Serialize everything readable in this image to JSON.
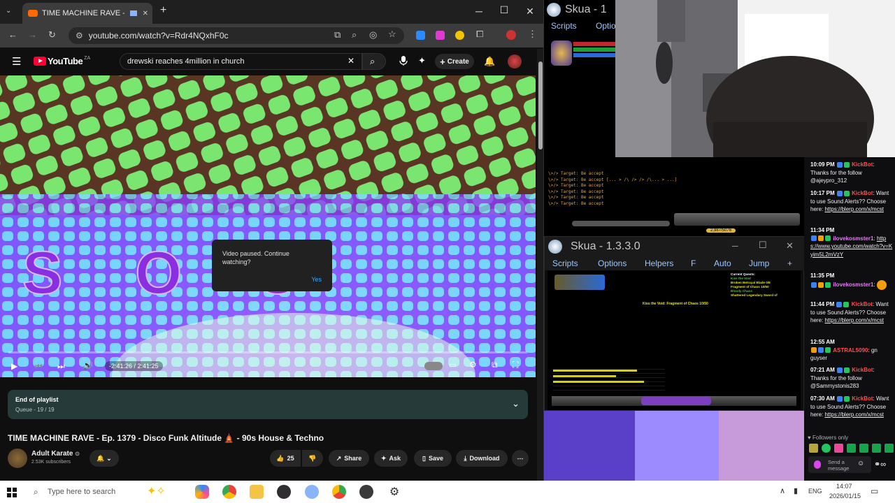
{
  "browser": {
    "tab_title": "TIME MACHINE RAVE - Ep.",
    "new_tab": "+",
    "minimize": "─",
    "maximize": "☐",
    "close": "✕",
    "url": "youtube.com/watch?v=Rdr4NQxhF0c"
  },
  "youtube": {
    "logo_text": "YouTube",
    "region": "ZA",
    "search_query": "drewski reaches 4million in church",
    "create_label": "Create",
    "player": {
      "overlay_letters": "S O C",
      "dialog_message": "Video paused. Continue watching?",
      "dialog_yes": "Yes",
      "time": "-2:41:26 / 2:41:25"
    },
    "playlist": {
      "title": "End of playlist",
      "queue": "Queue - 19 / 19"
    },
    "video_title": "TIME MACHINE RAVE - Ep. 1379 - Disco Funk Altitude 🛕 - 90s House & Techno",
    "channel_name": "Adult Karate",
    "subscribers": "2.53K subscribers",
    "likes": "25",
    "share": "Share",
    "ask": "Ask",
    "save": "Save",
    "download": "Download"
  },
  "skua_top": {
    "title": "Skua - 1",
    "menu_scripts": "Scripts",
    "menu_options": "Optio"
  },
  "skua_main": {
    "title": "Skua - 1.3.3.0",
    "menu": [
      "Scripts",
      "Options",
      "Helpers",
      "F",
      "Auto",
      "Jump",
      "+"
    ],
    "quest_header": "Current Quests:",
    "quest_lines": [
      "Kiss the Void",
      "Broken Betrayal Blade 0/8",
      "Fragment of Chaos 10/50",
      "Bloody Chaos",
      "Shattered Legendary Sword of"
    ],
    "center_text": "Kiss the Void: Fragment of Chaos 10/50"
  },
  "game_log": {
    "lines": [
      "\\>/> Target: Be accept",
      "\\>/> Target: Be accept  [... > /\\ /> /> /\\... > ...]",
      "\\>/> Target: Be accept",
      "\\>/> Target: Be accept",
      "\\>/> Target: Be accept",
      "\\>/> Target: Be accept"
    ],
    "level_bar": "2,987/5076"
  },
  "chat": {
    "messages": [
      {
        "time": "10:09 PM",
        "user": "KickBot",
        "text": "Thanks for the follow @ajeypro_312"
      },
      {
        "time": "10:17 PM",
        "user": "KickBot",
        "text": "Want to use Sound Alerts?? Choose here:",
        "link": "https://blerp.com/x/mcst"
      },
      {
        "time": "11:34 PM",
        "user": "ilovekosmster1",
        "text": "",
        "link": "https://www.youtube.com/watch?v=Kyim5L2mVzY"
      },
      {
        "time": "11:35 PM",
        "user": "ilovekosmster1",
        "text": ""
      },
      {
        "time": "11:44 PM",
        "user": "KickBot",
        "text": "Want to use Sound Alerts?? Choose here:",
        "link": "https://blerp.com/x/mcst"
      },
      {
        "time": "12:55 AM",
        "user": "ASTRAL5090",
        "text": "gn guyser"
      },
      {
        "time": "07:21 AM",
        "user": "KickBot",
        "text": "Thanks for the follow @Sammystonis283"
      },
      {
        "time": "07:30 AM",
        "user": "KickBot",
        "text": "Want to use Sound Alerts?? Choose here:",
        "link": "https://blerp.com/x/mcst"
      }
    ],
    "followers_only": "Followers only",
    "send_message": "Send a message"
  },
  "taskbar": {
    "search_placeholder": "Type here to search",
    "language": "ENG",
    "time": "14:07",
    "date": "2026/01/15"
  }
}
